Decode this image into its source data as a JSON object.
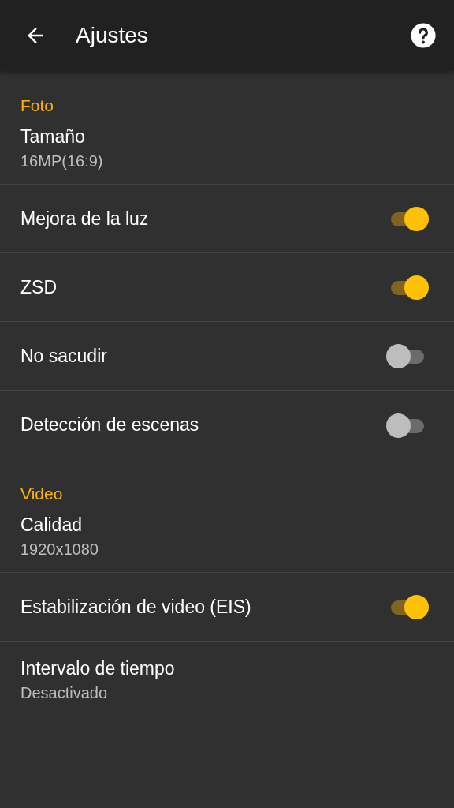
{
  "app_bar": {
    "title": "Ajustes"
  },
  "sections": [
    {
      "title": "Foto",
      "items": [
        {
          "kind": "value",
          "label": "Tamaño",
          "value": "16MP(16:9)"
        },
        {
          "kind": "toggle",
          "label": "Mejora de la luz",
          "on": true
        },
        {
          "kind": "toggle",
          "label": "ZSD",
          "on": true
        },
        {
          "kind": "toggle",
          "label": "No sacudir",
          "on": false
        },
        {
          "kind": "toggle",
          "label": "Detección de escenas",
          "on": false
        }
      ]
    },
    {
      "title": "Video",
      "items": [
        {
          "kind": "value",
          "label": "Calidad",
          "value": "1920x1080"
        },
        {
          "kind": "toggle",
          "label": "Estabilización de video (EIS)",
          "on": true
        },
        {
          "kind": "value",
          "label": "Intervalo de tiempo",
          "value": "Desactivado"
        }
      ]
    }
  ]
}
